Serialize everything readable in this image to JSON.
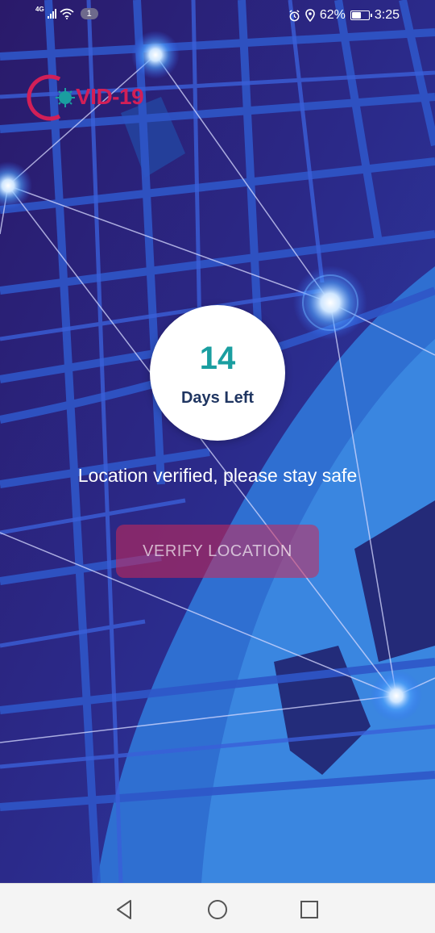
{
  "status_bar": {
    "network_type": "4G",
    "notification_count": "1",
    "battery_level": "62%",
    "battery_fraction": 0.62,
    "time": "3:25"
  },
  "logo": {
    "text": "VID-19",
    "full_name": "COVID-19",
    "color": "#d21f57"
  },
  "countdown": {
    "number": "14",
    "label": "Days Left"
  },
  "message": "Location verified, please stay safe",
  "verify_button": {
    "label": "VERIFY LOCATION"
  },
  "colors": {
    "accent_teal": "#1a9ea0",
    "label_navy": "#1f3561",
    "button_red": "#cd2855"
  },
  "nav_bar": {
    "back": "back-icon",
    "home": "home-icon",
    "recents": "recents-icon"
  }
}
